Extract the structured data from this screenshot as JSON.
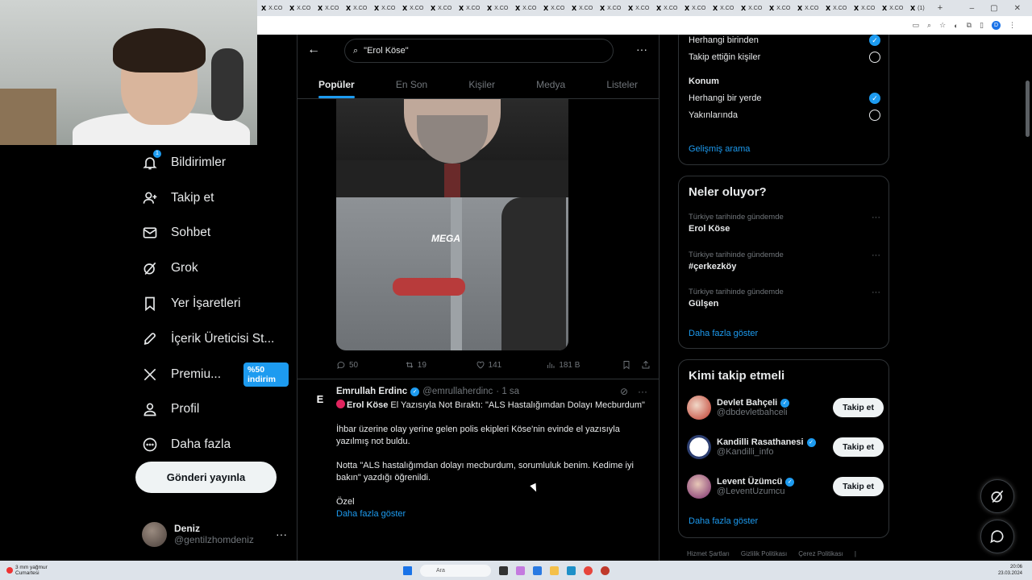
{
  "browser": {
    "tab_label": "X.CO",
    "tab_count": 24,
    "last_tab_label": "(1)",
    "new_tab": "+",
    "window_controls": [
      "–",
      "▢",
      "✕"
    ],
    "profile_letter": "D"
  },
  "nav": {
    "items": [
      {
        "label": "Bildirimler",
        "icon": "bell-icon",
        "badge": "1"
      },
      {
        "label": "Takip et",
        "icon": "person-add-icon"
      },
      {
        "label": "Sohbet",
        "icon": "mail-icon"
      },
      {
        "label": "Grok",
        "icon": "grok-icon"
      },
      {
        "label": "Yer İşaretleri",
        "icon": "bookmark-icon"
      },
      {
        "label": "İçerik Üreticisi St...",
        "icon": "rocket-icon"
      },
      {
        "label": "Premiu...",
        "icon": "x-logo-icon",
        "promo": "%50 indirim"
      },
      {
        "label": "Profil",
        "icon": "person-icon"
      },
      {
        "label": "Daha fazla",
        "icon": "more-circle-icon"
      }
    ],
    "post_button": "Gönderi yayınla",
    "user": {
      "name": "Deniz",
      "handle": "@gentilzhomdeniz"
    }
  },
  "search": {
    "query": "\"Erol Köse\"",
    "tabs": [
      "Popüler",
      "En Son",
      "Kişiler",
      "Medya",
      "Listeler"
    ],
    "active_tab": 0
  },
  "tweet1": {
    "watermark": "MEGA",
    "actions": {
      "replies": "50",
      "retweets": "19",
      "likes": "141",
      "views": "181 B"
    }
  },
  "tweet2": {
    "author": "Emrullah Erdinc",
    "handle": "@emrullaherdinc",
    "time": "· 1 sa",
    "avatar_letter": "E",
    "headline_bold": "Erol Köse",
    "headline_rest": " El Yazısıyla Not Bıraktı: \"ALS Hastalığımdan Dolayı Mecburdum\"",
    "paragraph1": "İhbar üzerine olay yerine gelen polis ekipleri Köse'nin evinde el yazısıyla yazılmış not buldu.",
    "paragraph2": "Notta \"ALS hastalığımdan dolayı mecburdum, sorumluluk benim. Kedime iyi bakın\" yazdığı öğrenildi.",
    "paragraph3": "Özel",
    "show_more": "Daha fazla göster"
  },
  "filters": {
    "people_options": [
      {
        "label": "Herhangi birinden",
        "checked": true
      },
      {
        "label": "Takip ettiğin kişiler",
        "checked": false
      }
    ],
    "location_title": "Konum",
    "location_options": [
      {
        "label": "Herhangi bir yerde",
        "checked": true
      },
      {
        "label": "Yakınlarında",
        "checked": false
      }
    ],
    "advanced_link": "Gelişmiş arama"
  },
  "trends": {
    "title": "Neler oluyor?",
    "items": [
      {
        "context": "Türkiye tarihinde gündemde",
        "topic": "Erol Köse"
      },
      {
        "context": "Türkiye tarihinde gündemde",
        "topic": "#çerkezköy"
      },
      {
        "context": "Türkiye tarihinde gündemde",
        "topic": "Gülşen"
      }
    ],
    "show_more": "Daha fazla göster"
  },
  "who_to_follow": {
    "title": "Kimi takip etmeli",
    "items": [
      {
        "name": "Devlet Bahçeli",
        "handle": "@dbdevletbahceli",
        "button": "Takip et"
      },
      {
        "name": "Kandilli Rasathanesi",
        "handle": "@Kandilli_info",
        "button": "Takip et"
      },
      {
        "name": "Levent Üzümcü",
        "handle": "@LeventUzumcu",
        "button": "Takip et"
      }
    ],
    "show_more": "Daha fazla göster"
  },
  "footer": {
    "links": [
      "Hizmet Şartları",
      "Gizlilik Politikası",
      "Çerez Politikası",
      "|"
    ]
  },
  "taskbar": {
    "weather_temp": "3 mm yağmur",
    "weather_day": "Cumartesi",
    "search_placeholder": "Ara",
    "time": "20:06",
    "date": "23.03.2024"
  },
  "colors": {
    "accent": "#1d9bf0",
    "background": "#000000",
    "border": "#2f3336",
    "muted": "#71767b",
    "text": "#e7e9ea"
  }
}
